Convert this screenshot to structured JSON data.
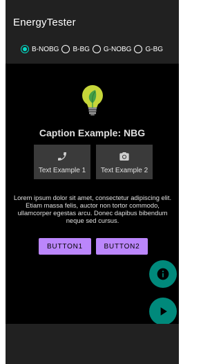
{
  "app": {
    "title": "EnergyTester"
  },
  "modes": {
    "selected_index": 0,
    "options": [
      {
        "label": "B-NOBG"
      },
      {
        "label": "B-BG"
      },
      {
        "label": "G-NOBG"
      },
      {
        "label": "G-BG"
      }
    ]
  },
  "main": {
    "icon": "lightbulb-leaf-icon",
    "caption": "Caption Example: NBG",
    "tiles": [
      {
        "label": "Text Example 1",
        "icon": "phone-icon"
      },
      {
        "label": "Text Example 2",
        "icon": "camera-icon"
      }
    ],
    "body_text": "Lorem ipsum dolor sit amet, consectetur adipiscing elit. Etiam massa felis, auctor non tortor commodo, ullamcorper egestas arcu. Donec dapibus bibendum neque sed cursus.",
    "button1_label": "BUTTON1",
    "button2_label": "BUTTON2"
  },
  "fabs": {
    "info_icon": "info-icon",
    "play_icon": "play-icon"
  },
  "colors": {
    "accent": "#03dac5",
    "button": "#bb86fc",
    "fab": "#00897b",
    "bar": "#212121",
    "background": "#000000"
  }
}
